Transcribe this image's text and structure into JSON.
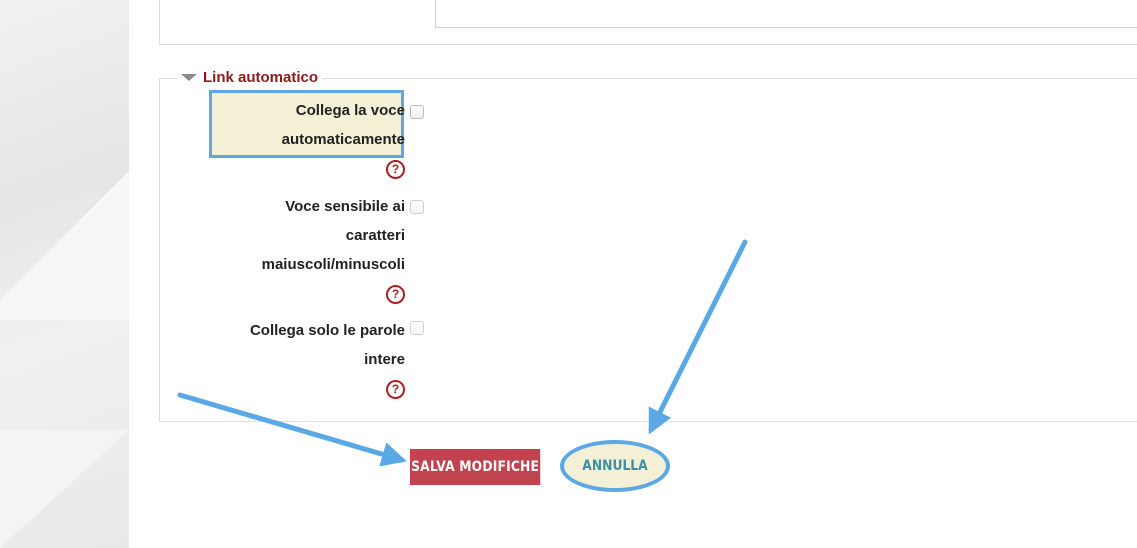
{
  "section": {
    "title": "Link automatico"
  },
  "fields": [
    {
      "label_lines": [
        "Collega la voce",
        "automaticamente"
      ],
      "help": "?",
      "checked": false
    },
    {
      "label_lines": [
        "Voce sensibile ai",
        "caratteri",
        "maiuscoli/minuscoli"
      ],
      "help": "?",
      "checked": false
    },
    {
      "label_lines": [
        "Collega solo le parole",
        "intere"
      ],
      "help": "?",
      "checked": false
    }
  ],
  "buttons": {
    "save": "SALVA MODIFICHE",
    "cancel": "ANNULLA"
  },
  "colors": {
    "section_title": "#8d1a1a",
    "help_icon": "#b01e23",
    "save_button": "#c0434f",
    "cancel_text": "#3d8fa6",
    "annotation": "#5aa8e6",
    "highlight_fill": "#f3f0d6"
  },
  "icons": {
    "collapse": "triangle-down-icon",
    "help": "question-circle-icon",
    "annotation": "arrow-icon"
  }
}
